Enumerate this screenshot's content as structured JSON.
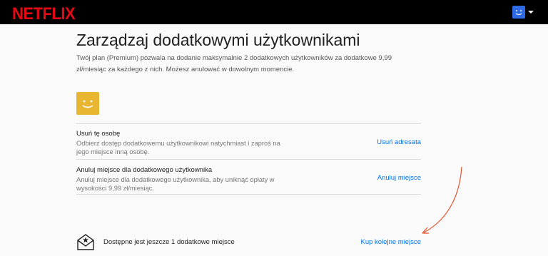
{
  "header": {
    "logo": "NETFLIX",
    "avatar_icon": "profile-avatar-icon",
    "menu_icon": "caret-down-icon"
  },
  "page": {
    "title": "Zarządzaj dodatkowymi użytkownikami",
    "description": "Twój plan (Premium) pozwala na dodanie maksymalnie 2 dodatkowych użytkowników za dodatkowe 9,99 zł/miesiąc za każdego z nich. Możesz anulować w dowolnym momencie."
  },
  "rows": [
    {
      "title": "Usuń tę osobę",
      "description": "Odbierz dostęp dodatkowemu użytkownikowi natychmiast i zaproś na jego miejsce inną osobę.",
      "action": "Usuń adresata"
    },
    {
      "title": "Anuluj miejsce dla dodatkowego użytkownika",
      "description": "Anuluj miejsce dla dodatkowego użytkownika, aby uniknąć opłaty w wysokości 9,99 zł/miesiąc.",
      "action": "Anuluj miejsce"
    }
  ],
  "footer": {
    "text": "Dostępne jest jeszcze 1 dodatkowe miejsce",
    "action": "Kup kolejne miejsce"
  },
  "colors": {
    "brand": "#e50914",
    "link": "#0073e6",
    "avatar_top": "#2f6ae5",
    "avatar_profile": "#e8b631",
    "arrow": "#e0552f"
  }
}
